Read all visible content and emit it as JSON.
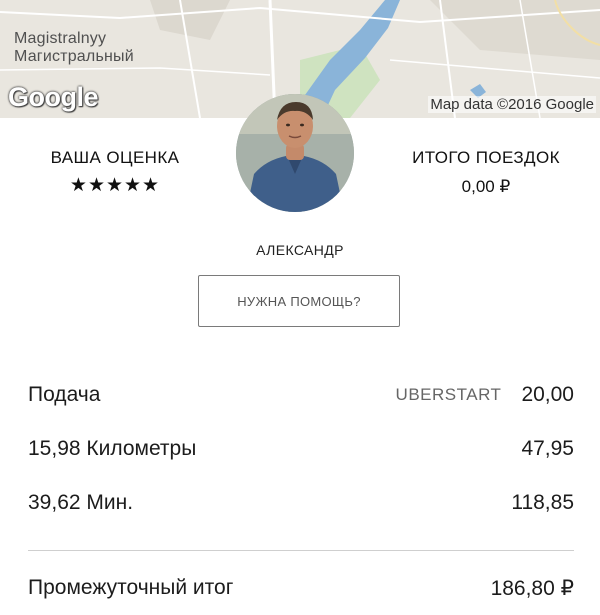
{
  "map": {
    "place_latin": "Magistralnyy",
    "place_cyrillic": "Магистральный",
    "logo_text": "Google",
    "attribution": "Map data ©2016 Google",
    "colors": {
      "land": "#e9e6df",
      "water": "#8ab4d9",
      "green": "#cfe3c0",
      "road": "#ffffff"
    }
  },
  "driver": {
    "rating_title": "ВАША ОЦЕНКА",
    "rating_stars": "★★★★★",
    "rating_value": 5,
    "trips_title": "ИТОГО ПОЕЗДОК",
    "trips_value": "0,00 ₽",
    "name": "АЛЕКСАНДР",
    "help_label": "НУЖНА ПОМОЩЬ?"
  },
  "fare": {
    "rows": [
      {
        "label": "Подача",
        "promo": "UBERSTART",
        "amount": "20,00"
      },
      {
        "label": "15,98 Километры",
        "amount": "47,95"
      },
      {
        "label": "39,62 Мин.",
        "amount": "118,85"
      }
    ],
    "subtotal_label": "Промежуточный итог",
    "subtotal_amount": "186,80 ₽"
  }
}
